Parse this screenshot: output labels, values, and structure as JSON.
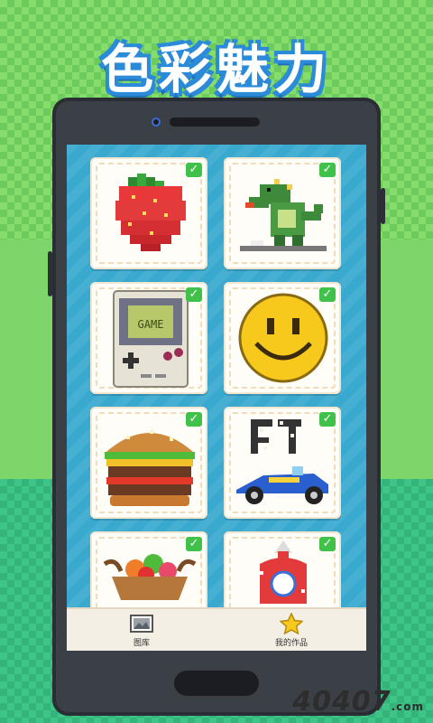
{
  "banner": {
    "title": "色彩魅力"
  },
  "gallery": {
    "items": [
      {
        "name": "strawberry",
        "completed": true
      },
      {
        "name": "dinosaur",
        "completed": true
      },
      {
        "name": "game-console",
        "completed": true
      },
      {
        "name": "smiley",
        "completed": true
      },
      {
        "name": "burger",
        "completed": true
      },
      {
        "name": "race-car",
        "completed": true
      },
      {
        "name": "fruit-basket",
        "completed": true
      },
      {
        "name": "rocket",
        "completed": true
      }
    ],
    "check_glyph": "✓"
  },
  "console_art": {
    "screen_text": "GAME"
  },
  "tabs": [
    {
      "label": "图库",
      "icon": "gallery-icon"
    },
    {
      "label": "我的作品",
      "icon": "star-icon"
    }
  ],
  "watermark": {
    "text": "40407",
    "suffix": ".com"
  },
  "colors": {
    "accent": "#39a9cf",
    "check": "#40c24a",
    "banner_outline": "#2b8bd8"
  }
}
